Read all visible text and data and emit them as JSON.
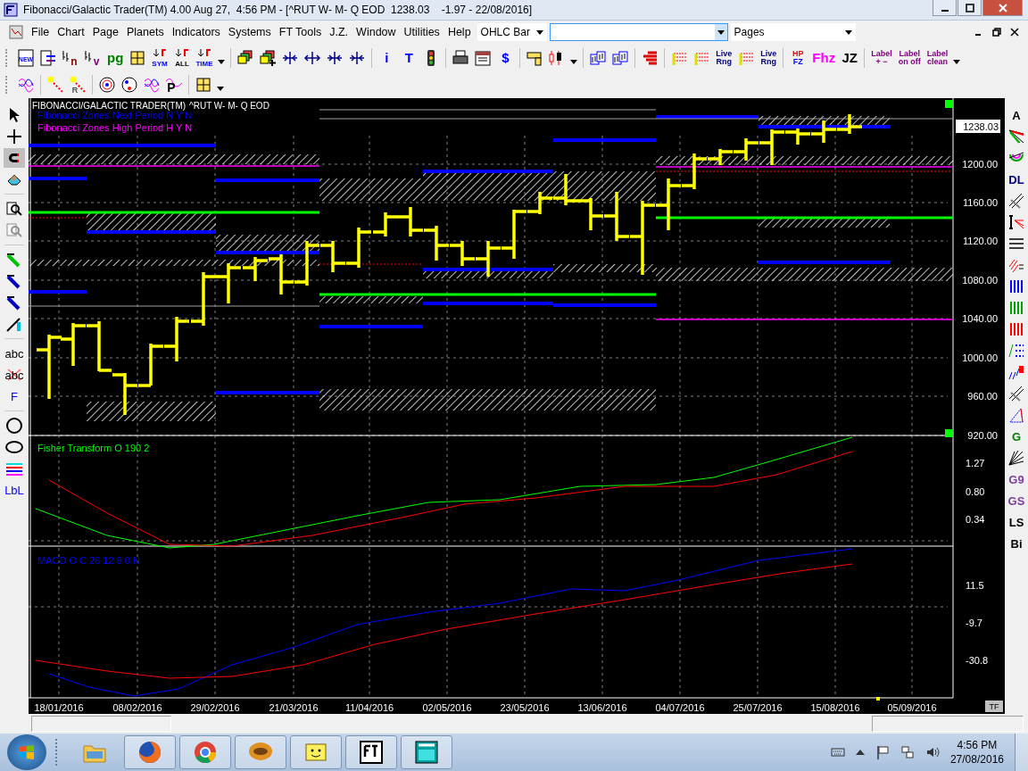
{
  "window": {
    "title": "Fibonacci/Galactic Trader(TM) 4.00 Aug 27,  4:56 PM - [^RUT W- M- Q EOD  1238.03    -1.97 - 22/08/2016]"
  },
  "menu": [
    "File",
    "Chart",
    "Page",
    "Planets",
    "Indicators",
    "Systems",
    "FT Tools",
    "J.Z.",
    "Window",
    "Utilities",
    "Help"
  ],
  "combos": [
    {
      "kind": "dropdown",
      "value": "OHLC Bar"
    },
    {
      "kind": "field"
    },
    {
      "kind": "dropdown",
      "value": "Pages"
    }
  ],
  "toolbar_1": [
    {
      "kind": "icon",
      "text": "NEW"
    },
    {
      "kind": "icon"
    },
    {
      "kind": "icon",
      "text": "n"
    },
    {
      "kind": "icon",
      "text": "v"
    },
    {
      "kind": "text",
      "lines": [
        "pg"
      ]
    },
    {
      "kind": "icon"
    },
    {
      "kind": "icon",
      "text": "SYM"
    },
    {
      "kind": "icon",
      "text": "ALL"
    },
    {
      "kind": "icon",
      "text": "TIME"
    },
    {
      "kind": "caret"
    },
    {
      "kind": "sep"
    },
    {
      "kind": "icon"
    },
    {
      "kind": "icon"
    },
    {
      "kind": "icon"
    },
    {
      "kind": "icon"
    },
    {
      "kind": "icon"
    },
    {
      "kind": "icon"
    },
    {
      "kind": "sep"
    },
    {
      "kind": "text",
      "lines": [
        "i"
      ]
    },
    {
      "kind": "text",
      "lines": [
        "T"
      ]
    },
    {
      "kind": "icon"
    },
    {
      "kind": "sep"
    },
    {
      "kind": "icon"
    },
    {
      "kind": "icon"
    },
    {
      "kind": "text",
      "lines": [
        "$"
      ]
    },
    {
      "kind": "sep"
    },
    {
      "kind": "icon"
    },
    {
      "kind": "icon"
    },
    {
      "kind": "caret"
    },
    {
      "kind": "sep"
    },
    {
      "kind": "icon"
    },
    {
      "kind": "icon"
    },
    {
      "kind": "sep"
    },
    {
      "kind": "icon"
    },
    {
      "kind": "sep"
    },
    {
      "kind": "icon"
    },
    {
      "kind": "icon"
    },
    {
      "kind": "text",
      "lines": [
        "Live",
        "Rng"
      ]
    },
    {
      "kind": "icon"
    },
    {
      "kind": "text",
      "lines": [
        "Live",
        "Rng"
      ]
    },
    {
      "kind": "sep"
    },
    {
      "kind": "text",
      "lines": [
        "HP",
        "FZ"
      ]
    },
    {
      "kind": "text",
      "lines": [
        "Fhz"
      ]
    },
    {
      "kind": "text",
      "lines": [
        "JZ"
      ]
    },
    {
      "kind": "sep"
    },
    {
      "kind": "text",
      "lines": [
        "Label",
        "+ −"
      ]
    },
    {
      "kind": "text",
      "lines": [
        "Label",
        "on off"
      ]
    },
    {
      "kind": "text",
      "lines": [
        "Label",
        "clean"
      ]
    },
    {
      "kind": "caret"
    }
  ],
  "toolbar_2": [
    {
      "kind": "icon"
    },
    {
      "kind": "sep"
    },
    {
      "kind": "icon"
    },
    {
      "kind": "icon",
      "text": "R"
    },
    {
      "kind": "sep"
    },
    {
      "kind": "icon"
    },
    {
      "kind": "icon"
    },
    {
      "kind": "icon"
    },
    {
      "kind": "icon",
      "text": "P"
    },
    {
      "kind": "sep"
    },
    {
      "kind": "icon"
    },
    {
      "kind": "caret"
    }
  ],
  "left_toolbar": [
    {
      "kind": "icon",
      "pressed": false,
      "disabled": false
    },
    {
      "kind": "icon",
      "pressed": false,
      "disabled": false
    },
    {
      "kind": "icon",
      "pressed": true,
      "disabled": false
    },
    {
      "kind": "icon",
      "pressed": false,
      "disabled": false
    },
    {
      "kind": "sep"
    },
    {
      "kind": "icon",
      "pressed": false,
      "disabled": false
    },
    {
      "kind": "icon",
      "pressed": false,
      "disabled": true
    },
    {
      "kind": "sep"
    },
    {
      "kind": "icon",
      "pressed": false,
      "disabled": false
    },
    {
      "kind": "icon",
      "pressed": false,
      "disabled": false
    },
    {
      "kind": "icon",
      "pressed": false,
      "disabled": false
    },
    {
      "kind": "icon",
      "pressed": false,
      "disabled": false
    },
    {
      "kind": "sep"
    },
    {
      "kind": "text",
      "text": "abc",
      "pressed": false,
      "disabled": false
    },
    {
      "kind": "text",
      "text": "abc",
      "pressed": false,
      "disabled": false
    },
    {
      "kind": "text",
      "text": "F",
      "pressed": false,
      "disabled": false
    },
    {
      "kind": "sep"
    },
    {
      "kind": "icon",
      "pressed": false,
      "disabled": false
    },
    {
      "kind": "icon",
      "pressed": false,
      "disabled": false
    },
    {
      "kind": "icon",
      "pressed": false,
      "disabled": false
    },
    {
      "kind": "text",
      "text": "LbL",
      "pressed": false,
      "disabled": false
    }
  ],
  "right_toolbar": [
    {
      "kind": "text",
      "text": "A"
    },
    {
      "kind": "icon"
    },
    {
      "kind": "icon"
    },
    {
      "kind": "text",
      "text": "DL"
    },
    {
      "kind": "icon"
    },
    {
      "kind": "icon"
    },
    {
      "kind": "icon"
    },
    {
      "kind": "icon"
    },
    {
      "kind": "icon"
    },
    {
      "kind": "icon"
    },
    {
      "kind": "icon"
    },
    {
      "kind": "icon"
    },
    {
      "kind": "icon"
    },
    {
      "kind": "icon"
    },
    {
      "kind": "icon"
    },
    {
      "kind": "text",
      "text": "G"
    },
    {
      "kind": "icon"
    },
    {
      "kind": "text",
      "text": "G9"
    },
    {
      "kind": "text",
      "text": "GS"
    },
    {
      "kind": "text",
      "text": "LS"
    },
    {
      "kind": "text",
      "text": "Bi"
    }
  ],
  "chart": {
    "title": "FIBONACCI/GALACTIC TRADER(TM)",
    "symbol": "^RUT W- M- Q EOD",
    "legends": [
      {
        "text": "Fibonacci Zones Next Period N Y N",
        "color": "#0000ff"
      },
      {
        "text": "Fibonacci Zones High Period H Y N",
        "color": "#ff00ff"
      },
      {
        "text": "Fisher Transform O 190 2",
        "color": "#00ff00"
      },
      {
        "text": "MACD O C 26 12 9 0 N",
        "color": "#0000ff"
      }
    ],
    "current_price": "1238.03",
    "price_axis": [
      "1200.00",
      "1160.00",
      "1120.00",
      "1080.00",
      "1040.00",
      "1000.00",
      "960.00",
      "920.00"
    ],
    "fisher_axis": [
      "1.27",
      "0.80",
      "0.34"
    ],
    "macd_axis": [
      "11.5",
      "-9.7",
      "-30.8"
    ],
    "dates": [
      "18/01/2016",
      "08/02/2016",
      "29/02/2016",
      "21/03/2016",
      "11/04/2016",
      "02/05/2016",
      "23/05/2016",
      "13/06/2016",
      "04/07/2016",
      "25/07/2016",
      "15/08/2016",
      "05/09/2016"
    ],
    "corner_button": "TF"
  },
  "taskbar": {
    "time": "4:56 PM",
    "date": "27/08/2016"
  }
}
